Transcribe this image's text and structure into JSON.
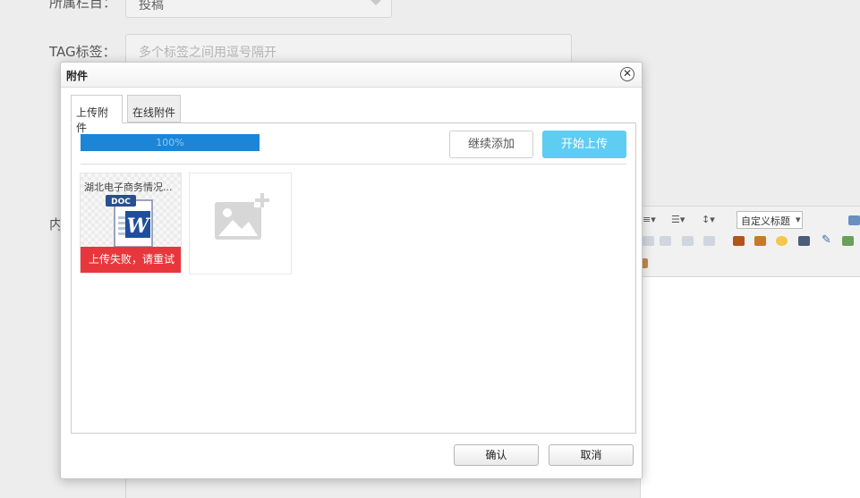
{
  "background": {
    "category_label": "所属栏目：",
    "category_value": "投稿",
    "tag_label": "TAG标签：",
    "tag_placeholder": "多个标签之间用逗号隔开",
    "content_label": "内",
    "editor_style_select": "自定义标题"
  },
  "dialog": {
    "title": "附件",
    "close_glyph": "✕",
    "tabs": [
      {
        "label": "上传附件",
        "active": true
      },
      {
        "label": "在线附件",
        "active": false
      }
    ],
    "progress": {
      "value": 1.0,
      "label": "100%"
    },
    "buttons": {
      "continue_add": "继续添加",
      "start_upload": "开始上传",
      "confirm": "确认",
      "cancel": "取消"
    },
    "files": [
      {
        "name": "湖北电子商务情况...",
        "icon": "word-doc-icon",
        "doc_badge": "DOC",
        "status": "上传失败，请重试",
        "status_color": "#e8373c"
      }
    ],
    "add_tile_icon": "add-image-icon"
  },
  "colors": {
    "progress_fill": "#1b86d8",
    "start_button": "#5fcdf1",
    "error": "#e8373c"
  }
}
